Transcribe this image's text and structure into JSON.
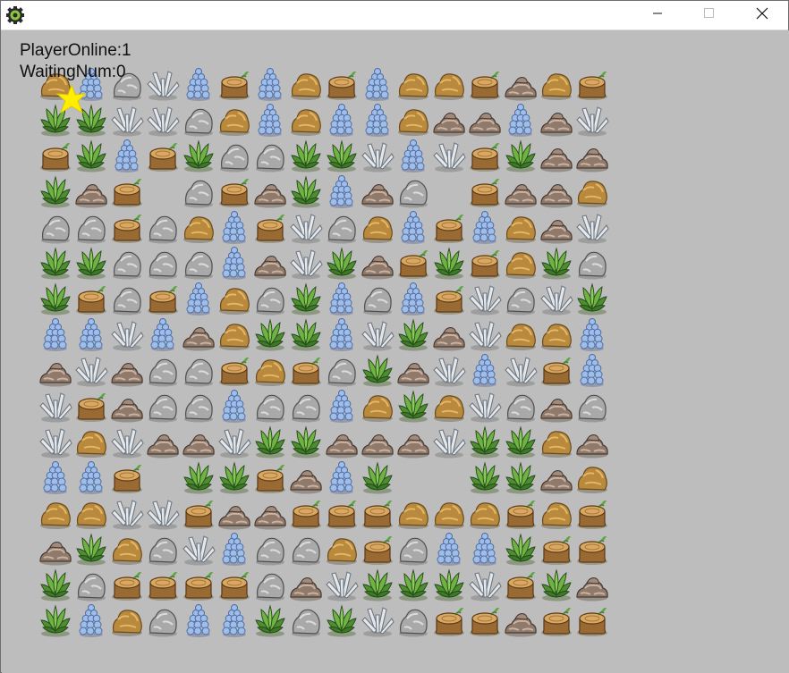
{
  "window": {
    "title": "",
    "icon": "gear-icon",
    "controls": [
      "minimize-icon",
      "maximize-icon",
      "close-icon"
    ]
  },
  "hud": {
    "player_online": "PlayerOnline:1",
    "waiting_num": "WaitingNum:0"
  },
  "colors": {
    "background": "#bdbdbd",
    "cursor": "#ffee00"
  },
  "tile_types": {
    "R": "brown-rock",
    "G": "gray-boulder",
    "B": "blue-crystal",
    "W": "white-crystal",
    "S": "tree-stump",
    "L": "leafy-bush",
    "P": "rock-pile",
    ".": "empty"
  },
  "board": {
    "rows": 16,
    "cols": 16,
    "cells": [
      "RBGWBSBRSBRRSPRS",
      "LLWWGRBRBBRPPBPW",
      "SLBSLGGLLWBWSLPP",
      "LPS.GSPLBPG.SPPR",
      "GGSGRBSWGRBSBRPW",
      "LLGGGBPWLPSLSRLG",
      "LSGSBRGLBGBSWGWL",
      "BBWBPRLLBWLPWRRB",
      "PWPGGSRSGLPWBWSB",
      "WSPGGBGGBRLRWGPG",
      "WRWPPWLLPPPWLLRP",
      "BBS.LLSPBL..LLPR",
      "RRWWSPPSSSRRRSRS",
      "PLRGWBGGRSGBBLSS",
      "LGSSSSGPWLLLWSLP",
      "LBRGBBLGLWGSSPSS"
    ],
    "selected": {
      "row": 1,
      "col": 1
    }
  }
}
